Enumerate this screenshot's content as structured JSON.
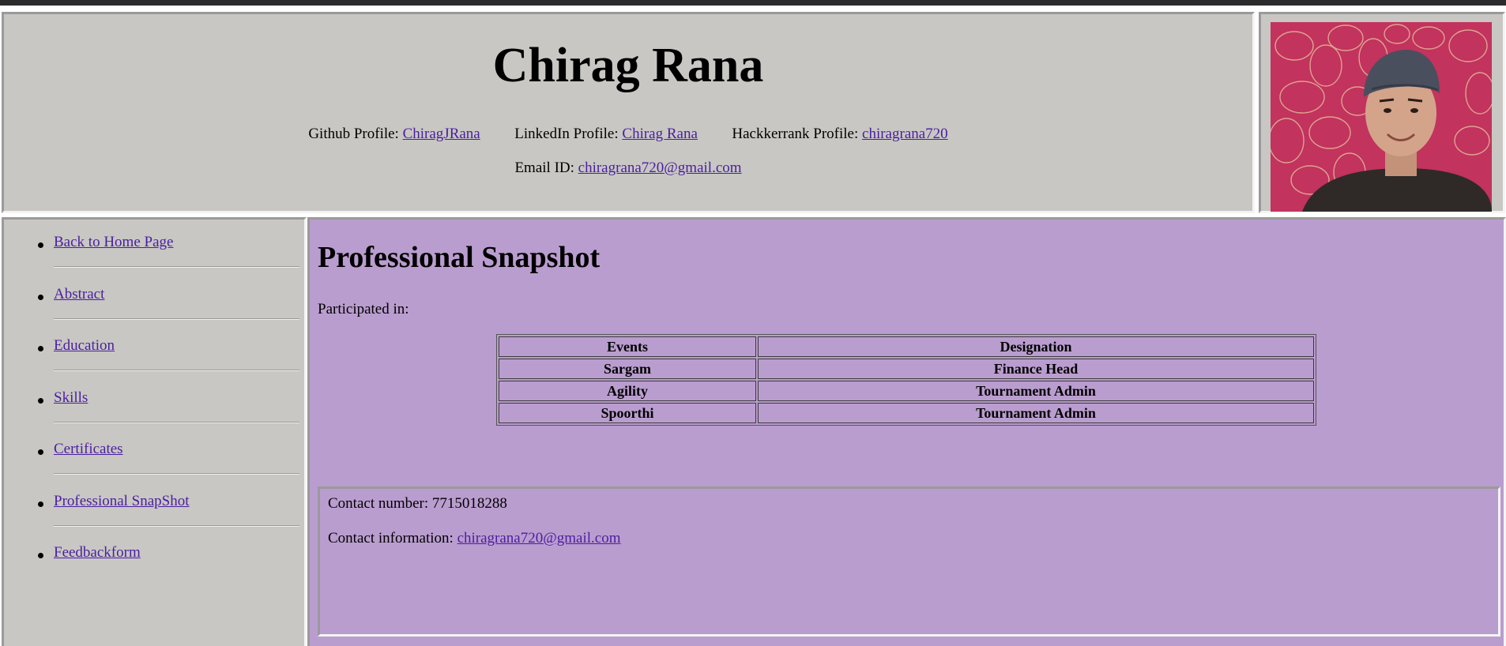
{
  "header": {
    "name": "Chirag Rana",
    "github": {
      "label": "Github Profile:",
      "link": "ChiragJRana"
    },
    "linkedin": {
      "label": "LinkedIn Profile:",
      "link": "Chirag Rana"
    },
    "hackerrank": {
      "label": "Hackkerrank Profile:",
      "link": "chiragrana720"
    },
    "email": {
      "label": "Email ID:",
      "link": "chiragrana720@gmail.com"
    }
  },
  "photo": {
    "alt": "Profile photo"
  },
  "nav": {
    "items": [
      {
        "label": "Back to Home Page"
      },
      {
        "label": "Abstract"
      },
      {
        "label": "Education"
      },
      {
        "label": "Skills"
      },
      {
        "label": "Certificates"
      },
      {
        "label": "Professional SnapShot"
      },
      {
        "label": "Feedbackform"
      }
    ]
  },
  "main": {
    "title": "Professional Snapshot",
    "intro": "Participated in:",
    "table": {
      "headers": [
        "Events",
        "Designation"
      ],
      "rows": [
        [
          "Sargam",
          "Finance Head"
        ],
        [
          "Agility",
          "Tournament Admin"
        ],
        [
          "Spoorthi",
          "Tournament Admin"
        ]
      ]
    },
    "contact": {
      "number_label": "Contact number:",
      "number": "7715018288",
      "info_label": "Contact information:",
      "info_link": "chiragrana720@gmail.com"
    }
  },
  "colors": {
    "header_bg": "#c8c7c3",
    "main_bg": "#ba9dcf",
    "link": "#4b1ea0",
    "topbar": "#2b2b2b"
  }
}
